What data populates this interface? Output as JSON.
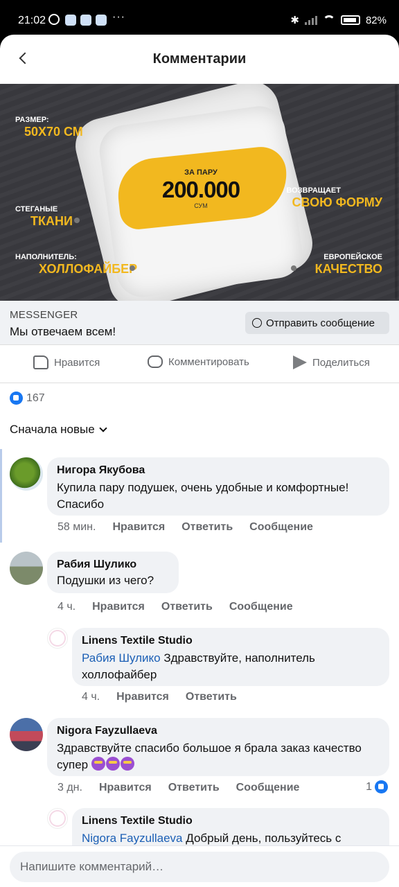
{
  "status_bar": {
    "time": "21:02",
    "battery": "82%"
  },
  "header": {
    "title": "Комментарии"
  },
  "ad": {
    "price_top": "ЗА ПАРУ",
    "price": "200.000",
    "currency": "СУМ",
    "size_label": "РАЗМЕР:",
    "size_value": "50Х70 СМ",
    "quilted_label": "СТЕГАНЫЕ",
    "quilted_value": "ТКАНИ",
    "filler_label": "НАПОЛНИТЕЛЬ:",
    "filler_value": "ХОЛЛОФАЙБЕР",
    "returns_label": "ВОЗВРАЩАЕТ",
    "returns_value": "СВОЮ ФОРМУ",
    "quality_label": "ЕВРОПЕЙСКОЕ",
    "quality_value": "КАЧЕСТВО",
    "accent_color": "#f2b81f"
  },
  "messenger": {
    "label": "MESSENGER",
    "text": "Мы отвечаем всем!",
    "button": "Отправить сообщение"
  },
  "actions": {
    "like": "Нравится",
    "comment": "Комментировать",
    "share": "Поделиться"
  },
  "reactions": {
    "count": "167"
  },
  "sort": {
    "label": "Сначала новые"
  },
  "comments": [
    {
      "name": "Нигора Якубова",
      "text": "Купила пару подушек, очень удобные и комфортные! Спасибо",
      "time": "58 мин.",
      "like": "Нравится",
      "reply": "Ответить",
      "message": "Сообщение"
    },
    {
      "name": "Рабия Шулико",
      "text": "Подушки из чего?",
      "time": "4 ч.",
      "like": "Нравится",
      "reply": "Ответить",
      "message": "Сообщение",
      "reply_item": {
        "name": "Linens Textile Studio",
        "mention": "Рабия Шулико",
        "text": " Здравствуйте, наполнитель холлофайбер",
        "time": "4 ч.",
        "like": "Нравится",
        "reply": "Ответить"
      }
    },
    {
      "name": "Nigora Fayzullaeva",
      "text": "Здравствуйте спасибо большое я брала заказ качество супер",
      "time": "3 дн.",
      "like": "Нравится",
      "reply": "Ответить",
      "message": "Сообщение",
      "likes": "1",
      "reply_item": {
        "name": "Linens Textile Studio",
        "mention": "Nigora Fayzullaeva",
        "text": " Добрый день, пользуйтесь с"
      }
    }
  ],
  "composer": {
    "placeholder": "Напишите комментарий…"
  }
}
